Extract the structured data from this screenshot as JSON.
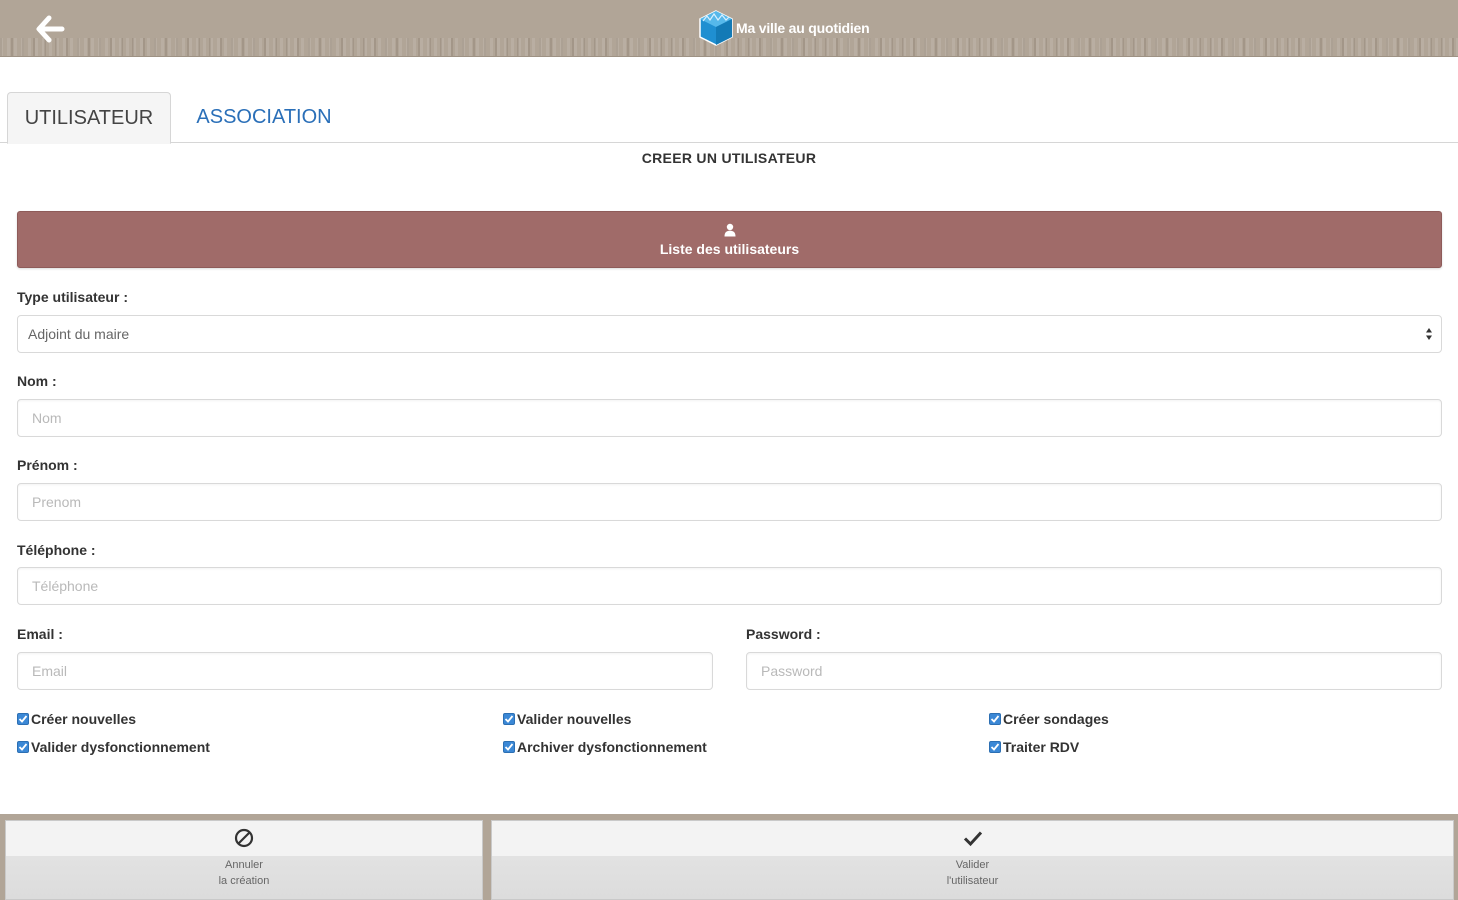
{
  "header": {
    "app_title": "Ma ville au quotidien",
    "back_icon": "arrow-left-icon",
    "logo_icon": "cube-logo-icon",
    "bg_color": "#b1a597"
  },
  "tabs": [
    {
      "label": "UTILISATEUR",
      "active": true
    },
    {
      "label": "ASSOCIATION",
      "active": false
    }
  ],
  "section_title": "CREER UN UTILISATEUR",
  "list_button": {
    "label": "Liste des utilisateurs",
    "icon": "user-icon",
    "color": "#a06b69"
  },
  "form": {
    "type_label": "Type utilisateur :",
    "type_value": "Adjoint du maire",
    "nom_label": "Nom :",
    "nom_placeholder": "Nom",
    "prenom_label": "Prénom :",
    "prenom_placeholder": "Prenom",
    "telephone_label": "Téléphone :",
    "telephone_placeholder": "Téléphone",
    "email_label": "Email :",
    "email_placeholder": "Email",
    "password_label": "Password :",
    "password_placeholder": "Password"
  },
  "permissions": [
    {
      "label": "Créer nouvelles",
      "checked": true
    },
    {
      "label": "Valider nouvelles",
      "checked": true
    },
    {
      "label": "Créer sondages",
      "checked": true
    },
    {
      "label": "Valider dysfonctionnement",
      "checked": true
    },
    {
      "label": "Archiver dysfonctionnement",
      "checked": true
    },
    {
      "label": "Traiter RDV",
      "checked": true
    }
  ],
  "footer": {
    "cancel_line1": "Annuler",
    "cancel_line2": "la création",
    "cancel_icon": "ban-icon",
    "validate_line1": "Valider",
    "validate_line2": "l'utilisateur",
    "validate_icon": "check-icon"
  }
}
